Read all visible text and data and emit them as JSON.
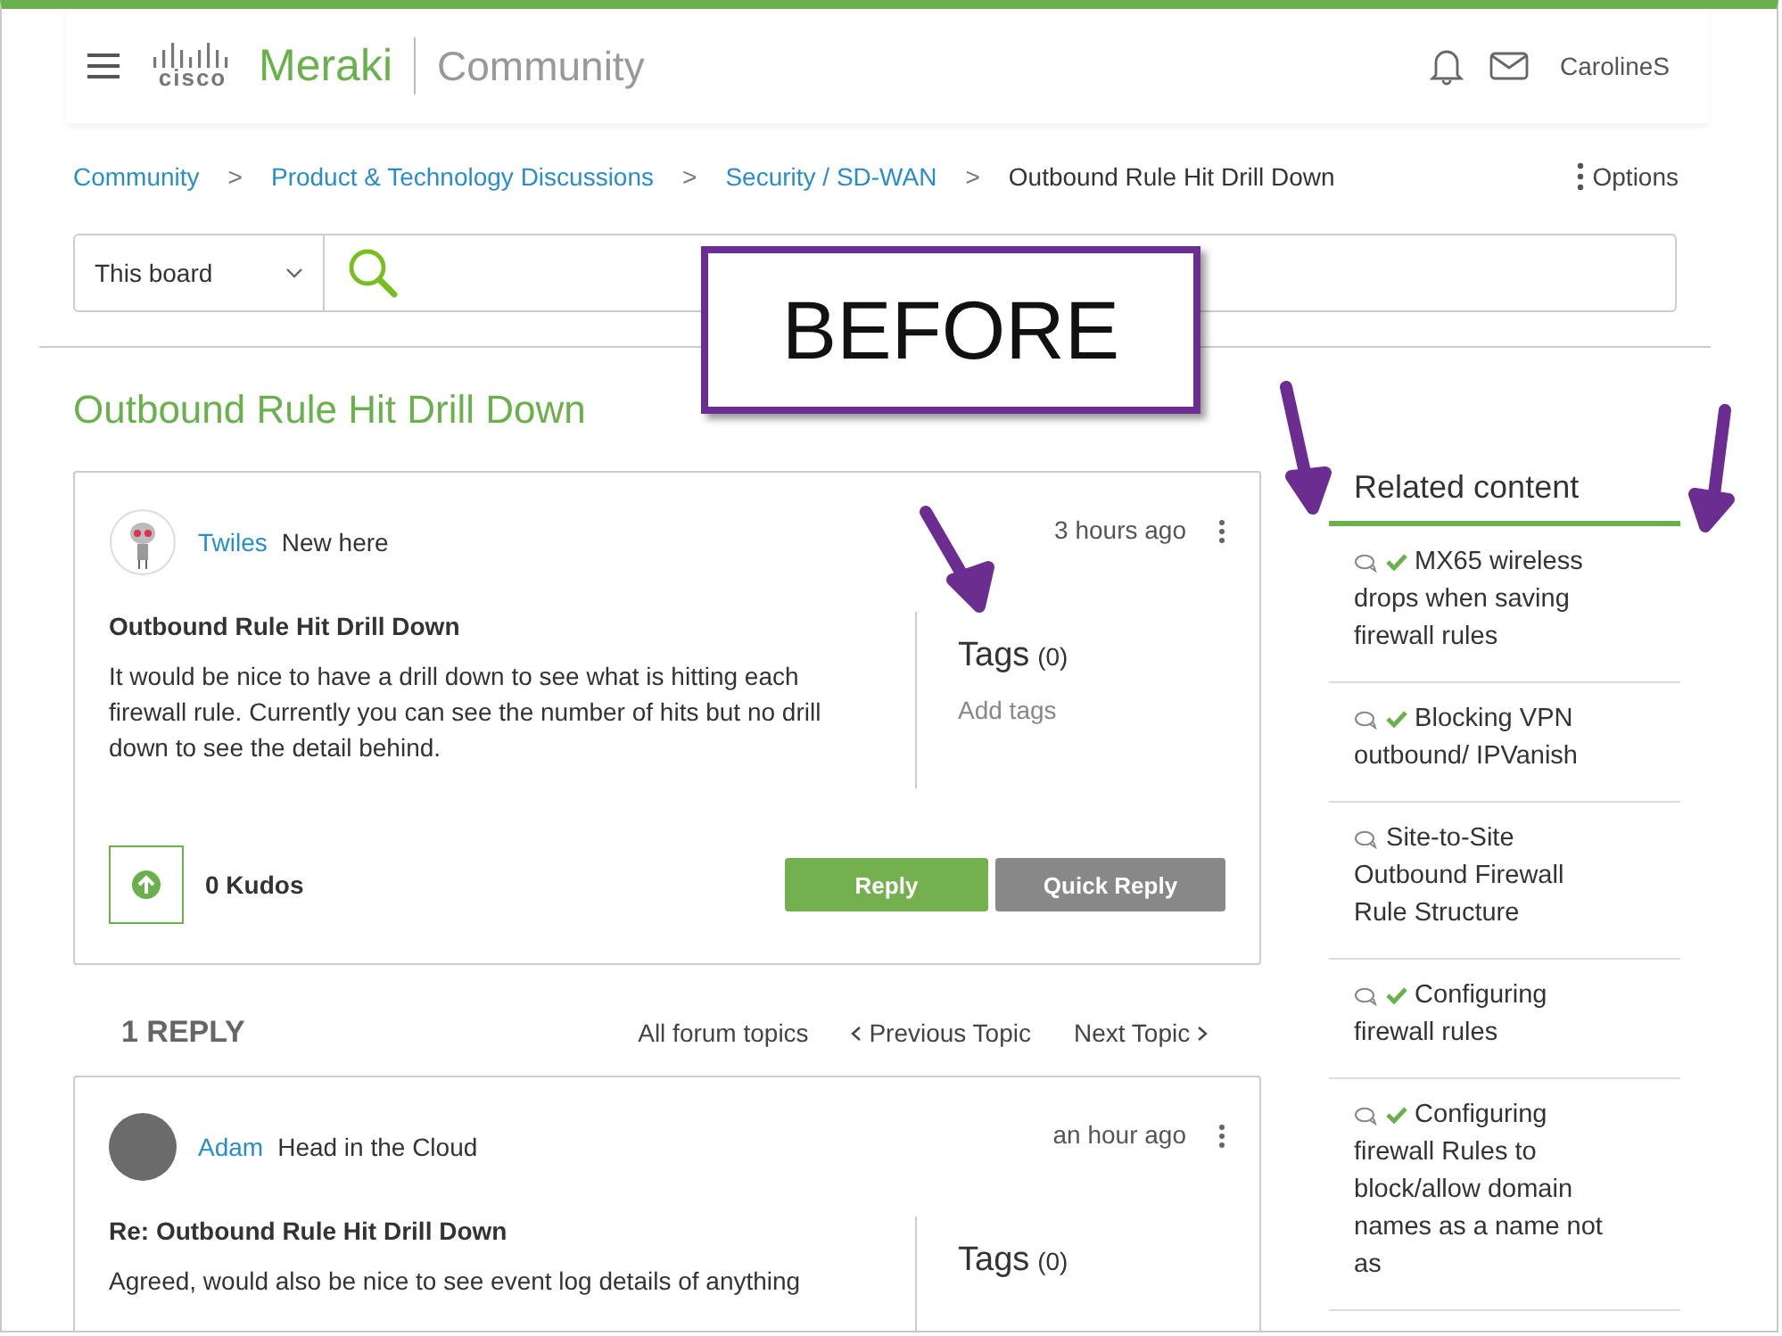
{
  "header": {
    "logo_text": "cisco",
    "product": "Meraki",
    "section": "Community",
    "user": "CarolineS"
  },
  "breadcrumbs": [
    {
      "label": "Community",
      "link": true
    },
    {
      "label": "Product & Technology Discussions",
      "link": true
    },
    {
      "label": "Security / SD-WAN",
      "link": true
    },
    {
      "label": "Outbound Rule Hit Drill Down",
      "link": false
    }
  ],
  "breadcrumb_separator": ">",
  "options": "Options",
  "search": {
    "scope": "This board"
  },
  "annotation": {
    "label": "BEFORE"
  },
  "title": "Outbound Rule Hit Drill Down",
  "post": {
    "author": "Twiles",
    "rank": "New here",
    "time": "3 hours ago",
    "subject": "Outbound Rule Hit Drill Down",
    "body": "It would be nice to have a drill down to see what is hitting each firewall rule. Currently you can see the number of hits but no drill down to see the detail behind.",
    "tags_label": "Tags",
    "tags_count": "(0)",
    "add_tags": "Add tags",
    "kudos": "0 Kudos",
    "buttons": [
      {
        "label": "Reply",
        "kind": "primary"
      },
      {
        "label": "Quick Reply",
        "kind": "secondary"
      }
    ]
  },
  "reply_count": "1 REPLY",
  "topic_nav": {
    "all": "All forum topics",
    "previous": "Previous Topic",
    "next": "Next Topic"
  },
  "reply": {
    "author": "Adam",
    "rank": "Head in the Cloud",
    "time": "an hour ago",
    "subject": "Re: Outbound Rule Hit Drill Down",
    "body": "Agreed, would also be nice to see event log details of anything",
    "tags_label": "Tags",
    "tags_count": "(0)"
  },
  "related": {
    "title": "Related content",
    "items": [
      {
        "title": "MX65 wireless drops when saving firewall rules",
        "solved": true
      },
      {
        "title": "Blocking VPN outbound/ IPVanish",
        "solved": true
      },
      {
        "title": "Site-to-Site Outbound Firewall Rule Structure",
        "solved": false
      },
      {
        "title": "Configuring firewall rules",
        "solved": true
      },
      {
        "title": "Configuring firewall Rules to block/allow domain names as a name not as",
        "solved": true
      }
    ]
  }
}
